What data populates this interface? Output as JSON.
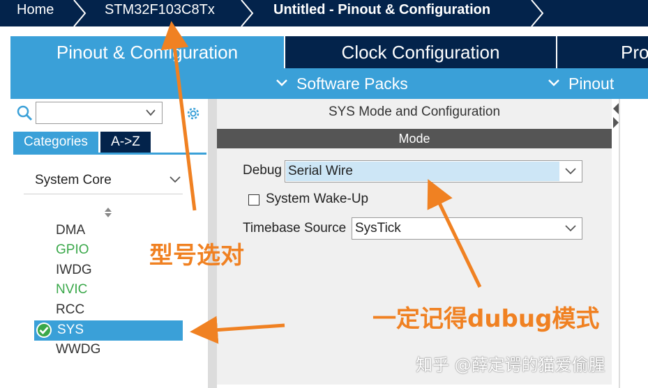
{
  "breadcrumb": {
    "home": "Home",
    "device": "STM32F103C8Tx",
    "project": "Untitled - Pinout & Configuration"
  },
  "tabs": {
    "pinout": "Pinout & Configuration",
    "clock": "Clock Configuration",
    "project_partial": "Pro"
  },
  "subbar": {
    "software_packs": "Software Packs",
    "pinout": "Pinout"
  },
  "left": {
    "search_value": "",
    "categories_tab": "Categories",
    "az_tab": "A->Z",
    "category_select": "System Core",
    "items": [
      {
        "label": "DMA",
        "color": "#333333"
      },
      {
        "label": "GPIO",
        "color": "#3aa84a"
      },
      {
        "label": "IWDG",
        "color": "#333333"
      },
      {
        "label": "NVIC",
        "color": "#3aa84a"
      },
      {
        "label": "RCC",
        "color": "#333333"
      },
      {
        "label": "SYS",
        "color": "#ffffff"
      },
      {
        "label": "WWDG",
        "color": "#333333"
      }
    ]
  },
  "center": {
    "title": "SYS Mode and Configuration",
    "mode_header": "Mode",
    "debug_label": "Debug",
    "debug_value": "Serial Wire",
    "wakeup_label": "System Wake-Up",
    "timebase_label": "Timebase Source",
    "timebase_value": "SysTick"
  },
  "annotations": {
    "model": "型号选对",
    "debug_mode": "一定记得dubug模式",
    "watermark": "知乎 @薛定谔的猫爱偷腥"
  },
  "colors": {
    "navy": "#03234b",
    "accent_blue": "#3aa0d8",
    "annotation_orange": "#f08122",
    "enabled_green": "#3aa84a"
  }
}
